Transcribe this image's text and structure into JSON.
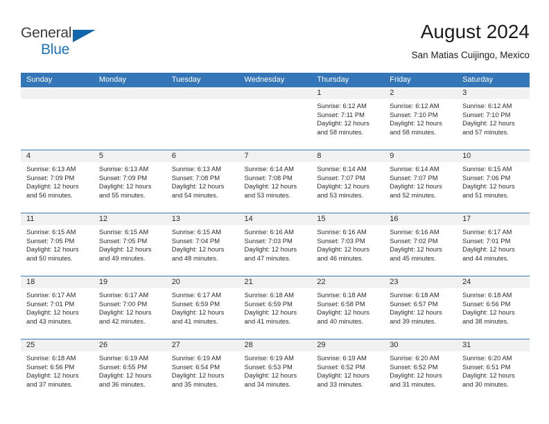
{
  "brand": {
    "name_top": "General",
    "name_bottom": "Blue",
    "accent_color": "#1a74bd",
    "triangle_color": "#1265ab",
    "logo_icon": "triangle-flag-icon"
  },
  "header": {
    "title": "August 2024",
    "subtitle": "San Matias Cuijingo, Mexico"
  },
  "theme": {
    "header_bg": "#3576b8",
    "day_band_bg": "#f1f1f1",
    "grid_line": "#3576b8",
    "text": "#2b2b2b"
  },
  "weekdays": [
    "Sunday",
    "Monday",
    "Tuesday",
    "Wednesday",
    "Thursday",
    "Friday",
    "Saturday"
  ],
  "weeks": [
    [
      {
        "day": "",
        "sunrise": "",
        "sunset": "",
        "daylight1": "",
        "daylight2": ""
      },
      {
        "day": "",
        "sunrise": "",
        "sunset": "",
        "daylight1": "",
        "daylight2": ""
      },
      {
        "day": "",
        "sunrise": "",
        "sunset": "",
        "daylight1": "",
        "daylight2": ""
      },
      {
        "day": "",
        "sunrise": "",
        "sunset": "",
        "daylight1": "",
        "daylight2": ""
      },
      {
        "day": "1",
        "sunrise": "Sunrise: 6:12 AM",
        "sunset": "Sunset: 7:11 PM",
        "daylight1": "Daylight: 12 hours",
        "daylight2": "and 58 minutes."
      },
      {
        "day": "2",
        "sunrise": "Sunrise: 6:12 AM",
        "sunset": "Sunset: 7:10 PM",
        "daylight1": "Daylight: 12 hours",
        "daylight2": "and 58 minutes."
      },
      {
        "day": "3",
        "sunrise": "Sunrise: 6:12 AM",
        "sunset": "Sunset: 7:10 PM",
        "daylight1": "Daylight: 12 hours",
        "daylight2": "and 57 minutes."
      }
    ],
    [
      {
        "day": "4",
        "sunrise": "Sunrise: 6:13 AM",
        "sunset": "Sunset: 7:09 PM",
        "daylight1": "Daylight: 12 hours",
        "daylight2": "and 56 minutes."
      },
      {
        "day": "5",
        "sunrise": "Sunrise: 6:13 AM",
        "sunset": "Sunset: 7:09 PM",
        "daylight1": "Daylight: 12 hours",
        "daylight2": "and 55 minutes."
      },
      {
        "day": "6",
        "sunrise": "Sunrise: 6:13 AM",
        "sunset": "Sunset: 7:08 PM",
        "daylight1": "Daylight: 12 hours",
        "daylight2": "and 54 minutes."
      },
      {
        "day": "7",
        "sunrise": "Sunrise: 6:14 AM",
        "sunset": "Sunset: 7:08 PM",
        "daylight1": "Daylight: 12 hours",
        "daylight2": "and 53 minutes."
      },
      {
        "day": "8",
        "sunrise": "Sunrise: 6:14 AM",
        "sunset": "Sunset: 7:07 PM",
        "daylight1": "Daylight: 12 hours",
        "daylight2": "and 53 minutes."
      },
      {
        "day": "9",
        "sunrise": "Sunrise: 6:14 AM",
        "sunset": "Sunset: 7:07 PM",
        "daylight1": "Daylight: 12 hours",
        "daylight2": "and 52 minutes."
      },
      {
        "day": "10",
        "sunrise": "Sunrise: 6:15 AM",
        "sunset": "Sunset: 7:06 PM",
        "daylight1": "Daylight: 12 hours",
        "daylight2": "and 51 minutes."
      }
    ],
    [
      {
        "day": "11",
        "sunrise": "Sunrise: 6:15 AM",
        "sunset": "Sunset: 7:05 PM",
        "daylight1": "Daylight: 12 hours",
        "daylight2": "and 50 minutes."
      },
      {
        "day": "12",
        "sunrise": "Sunrise: 6:15 AM",
        "sunset": "Sunset: 7:05 PM",
        "daylight1": "Daylight: 12 hours",
        "daylight2": "and 49 minutes."
      },
      {
        "day": "13",
        "sunrise": "Sunrise: 6:15 AM",
        "sunset": "Sunset: 7:04 PM",
        "daylight1": "Daylight: 12 hours",
        "daylight2": "and 48 minutes."
      },
      {
        "day": "14",
        "sunrise": "Sunrise: 6:16 AM",
        "sunset": "Sunset: 7:03 PM",
        "daylight1": "Daylight: 12 hours",
        "daylight2": "and 47 minutes."
      },
      {
        "day": "15",
        "sunrise": "Sunrise: 6:16 AM",
        "sunset": "Sunset: 7:03 PM",
        "daylight1": "Daylight: 12 hours",
        "daylight2": "and 46 minutes."
      },
      {
        "day": "16",
        "sunrise": "Sunrise: 6:16 AM",
        "sunset": "Sunset: 7:02 PM",
        "daylight1": "Daylight: 12 hours",
        "daylight2": "and 45 minutes."
      },
      {
        "day": "17",
        "sunrise": "Sunrise: 6:17 AM",
        "sunset": "Sunset: 7:01 PM",
        "daylight1": "Daylight: 12 hours",
        "daylight2": "and 44 minutes."
      }
    ],
    [
      {
        "day": "18",
        "sunrise": "Sunrise: 6:17 AM",
        "sunset": "Sunset: 7:01 PM",
        "daylight1": "Daylight: 12 hours",
        "daylight2": "and 43 minutes."
      },
      {
        "day": "19",
        "sunrise": "Sunrise: 6:17 AM",
        "sunset": "Sunset: 7:00 PM",
        "daylight1": "Daylight: 12 hours",
        "daylight2": "and 42 minutes."
      },
      {
        "day": "20",
        "sunrise": "Sunrise: 6:17 AM",
        "sunset": "Sunset: 6:59 PM",
        "daylight1": "Daylight: 12 hours",
        "daylight2": "and 41 minutes."
      },
      {
        "day": "21",
        "sunrise": "Sunrise: 6:18 AM",
        "sunset": "Sunset: 6:59 PM",
        "daylight1": "Daylight: 12 hours",
        "daylight2": "and 41 minutes."
      },
      {
        "day": "22",
        "sunrise": "Sunrise: 6:18 AM",
        "sunset": "Sunset: 6:58 PM",
        "daylight1": "Daylight: 12 hours",
        "daylight2": "and 40 minutes."
      },
      {
        "day": "23",
        "sunrise": "Sunrise: 6:18 AM",
        "sunset": "Sunset: 6:57 PM",
        "daylight1": "Daylight: 12 hours",
        "daylight2": "and 39 minutes."
      },
      {
        "day": "24",
        "sunrise": "Sunrise: 6:18 AM",
        "sunset": "Sunset: 6:56 PM",
        "daylight1": "Daylight: 12 hours",
        "daylight2": "and 38 minutes."
      }
    ],
    [
      {
        "day": "25",
        "sunrise": "Sunrise: 6:18 AM",
        "sunset": "Sunset: 6:56 PM",
        "daylight1": "Daylight: 12 hours",
        "daylight2": "and 37 minutes."
      },
      {
        "day": "26",
        "sunrise": "Sunrise: 6:19 AM",
        "sunset": "Sunset: 6:55 PM",
        "daylight1": "Daylight: 12 hours",
        "daylight2": "and 36 minutes."
      },
      {
        "day": "27",
        "sunrise": "Sunrise: 6:19 AM",
        "sunset": "Sunset: 6:54 PM",
        "daylight1": "Daylight: 12 hours",
        "daylight2": "and 35 minutes."
      },
      {
        "day": "28",
        "sunrise": "Sunrise: 6:19 AM",
        "sunset": "Sunset: 6:53 PM",
        "daylight1": "Daylight: 12 hours",
        "daylight2": "and 34 minutes."
      },
      {
        "day": "29",
        "sunrise": "Sunrise: 6:19 AM",
        "sunset": "Sunset: 6:52 PM",
        "daylight1": "Daylight: 12 hours",
        "daylight2": "and 33 minutes."
      },
      {
        "day": "30",
        "sunrise": "Sunrise: 6:20 AM",
        "sunset": "Sunset: 6:52 PM",
        "daylight1": "Daylight: 12 hours",
        "daylight2": "and 31 minutes."
      },
      {
        "day": "31",
        "sunrise": "Sunrise: 6:20 AM",
        "sunset": "Sunset: 6:51 PM",
        "daylight1": "Daylight: 12 hours",
        "daylight2": "and 30 minutes."
      }
    ]
  ]
}
